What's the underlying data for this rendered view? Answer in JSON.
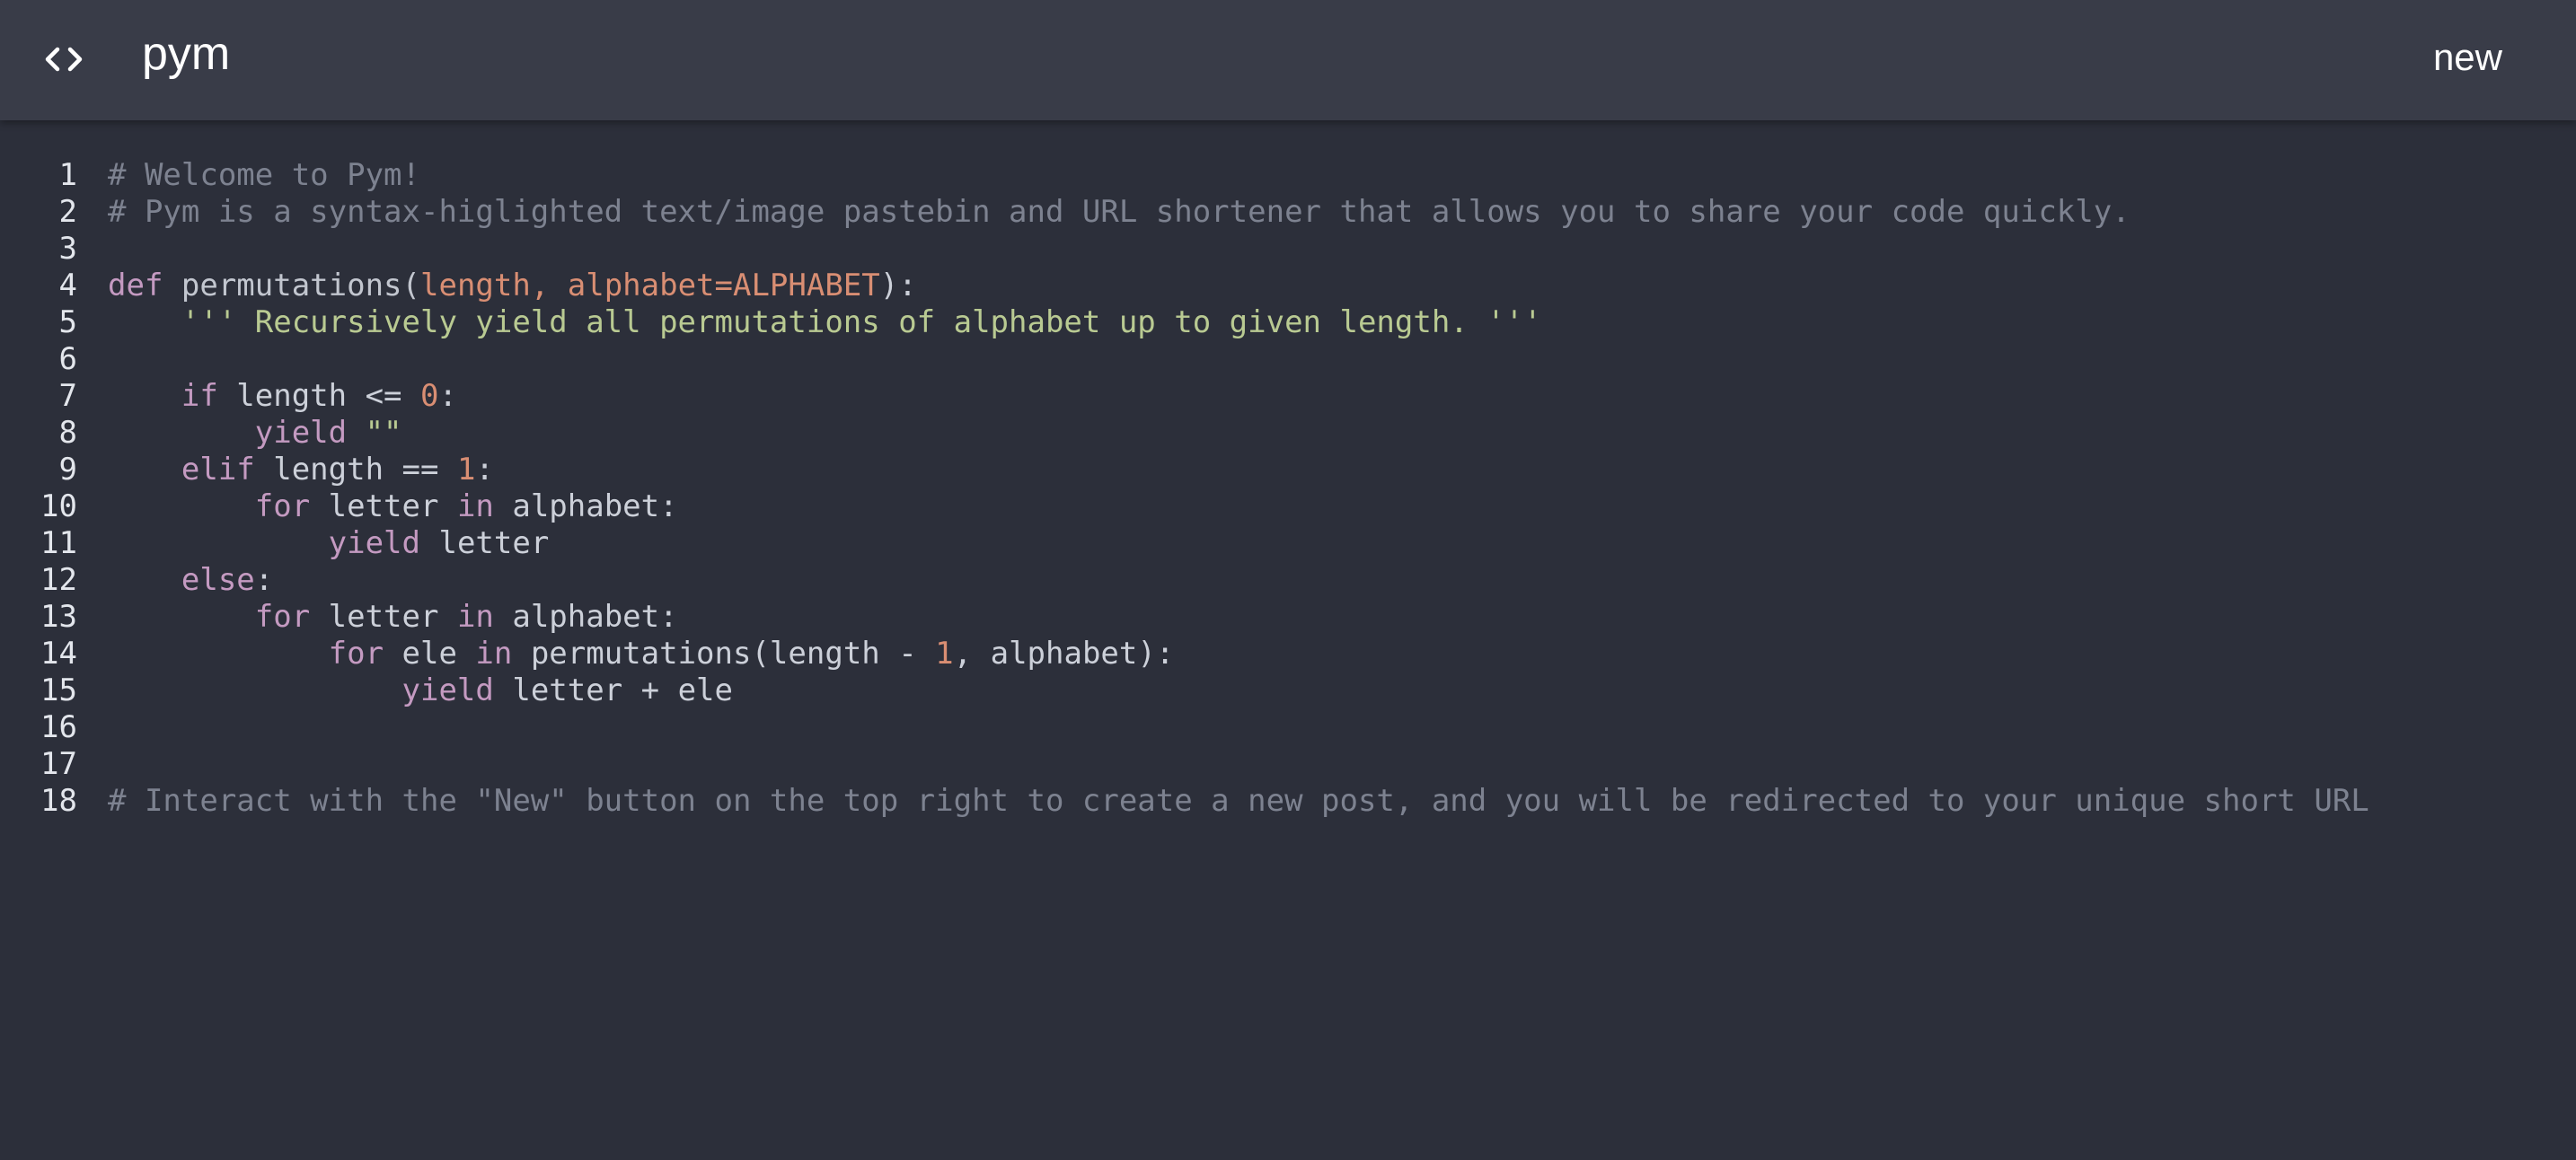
{
  "app": {
    "title": "pym",
    "new_button_label": "new",
    "logo_icon": "code-brackets-icon"
  },
  "colors": {
    "background": "#2c2f3a",
    "header": "#393c48",
    "comment": "#7d8290",
    "keyword": "#c49ac1",
    "param": "#d98e73",
    "string": "#b9ca92",
    "text": "#ccd0d9"
  },
  "editor": {
    "lines": [
      {
        "num": "1",
        "tokens": [
          {
            "t": "comment",
            "v": "# Welcome to Pym!"
          }
        ]
      },
      {
        "num": "2",
        "tokens": [
          {
            "t": "comment",
            "v": "# Pym is a syntax-higlighted text/image pastebin and URL shortener that allows you to share your code quickly."
          }
        ]
      },
      {
        "num": "3",
        "tokens": []
      },
      {
        "num": "4",
        "tokens": [
          {
            "t": "kw",
            "v": "def "
          },
          {
            "t": "fn",
            "v": "permutations("
          },
          {
            "t": "param",
            "v": "length, alphabet=ALPHABET"
          },
          {
            "t": "text",
            "v": "):"
          }
        ]
      },
      {
        "num": "5",
        "tokens": [
          {
            "t": "str",
            "v": "    ''' Recursively yield all permutations of alphabet up to given length. '''"
          }
        ]
      },
      {
        "num": "6",
        "tokens": []
      },
      {
        "num": "7",
        "tokens": [
          {
            "t": "kw",
            "v": "    if "
          },
          {
            "t": "text",
            "v": "length <= "
          },
          {
            "t": "num",
            "v": "0"
          },
          {
            "t": "text",
            "v": ":"
          }
        ]
      },
      {
        "num": "8",
        "tokens": [
          {
            "t": "kw",
            "v": "        yield "
          },
          {
            "t": "str",
            "v": "\"\""
          }
        ]
      },
      {
        "num": "9",
        "tokens": [
          {
            "t": "kw",
            "v": "    elif "
          },
          {
            "t": "text",
            "v": "length == "
          },
          {
            "t": "num",
            "v": "1"
          },
          {
            "t": "text",
            "v": ":"
          }
        ]
      },
      {
        "num": "10",
        "tokens": [
          {
            "t": "kw",
            "v": "        for "
          },
          {
            "t": "text",
            "v": "letter "
          },
          {
            "t": "kw",
            "v": "in "
          },
          {
            "t": "text",
            "v": "alphabet:"
          }
        ]
      },
      {
        "num": "11",
        "tokens": [
          {
            "t": "kw",
            "v": "            yield "
          },
          {
            "t": "text",
            "v": "letter"
          }
        ]
      },
      {
        "num": "12",
        "tokens": [
          {
            "t": "kw",
            "v": "    else"
          },
          {
            "t": "text",
            "v": ":"
          }
        ]
      },
      {
        "num": "13",
        "tokens": [
          {
            "t": "kw",
            "v": "        for "
          },
          {
            "t": "text",
            "v": "letter "
          },
          {
            "t": "kw",
            "v": "in "
          },
          {
            "t": "text",
            "v": "alphabet:"
          }
        ]
      },
      {
        "num": "14",
        "tokens": [
          {
            "t": "kw",
            "v": "            for "
          },
          {
            "t": "text",
            "v": "ele "
          },
          {
            "t": "kw",
            "v": "in "
          },
          {
            "t": "text",
            "v": "permutations(length - "
          },
          {
            "t": "num",
            "v": "1"
          },
          {
            "t": "text",
            "v": ", alphabet):"
          }
        ]
      },
      {
        "num": "15",
        "tokens": [
          {
            "t": "kw",
            "v": "                yield "
          },
          {
            "t": "text",
            "v": "letter + ele"
          }
        ]
      },
      {
        "num": "16",
        "tokens": []
      },
      {
        "num": "17",
        "tokens": []
      },
      {
        "num": "18",
        "tokens": [
          {
            "t": "comment",
            "v": "# Interact with the \"New\" button on the top right to create a new post, and you will be redirected to your unique short URL"
          }
        ]
      }
    ]
  }
}
